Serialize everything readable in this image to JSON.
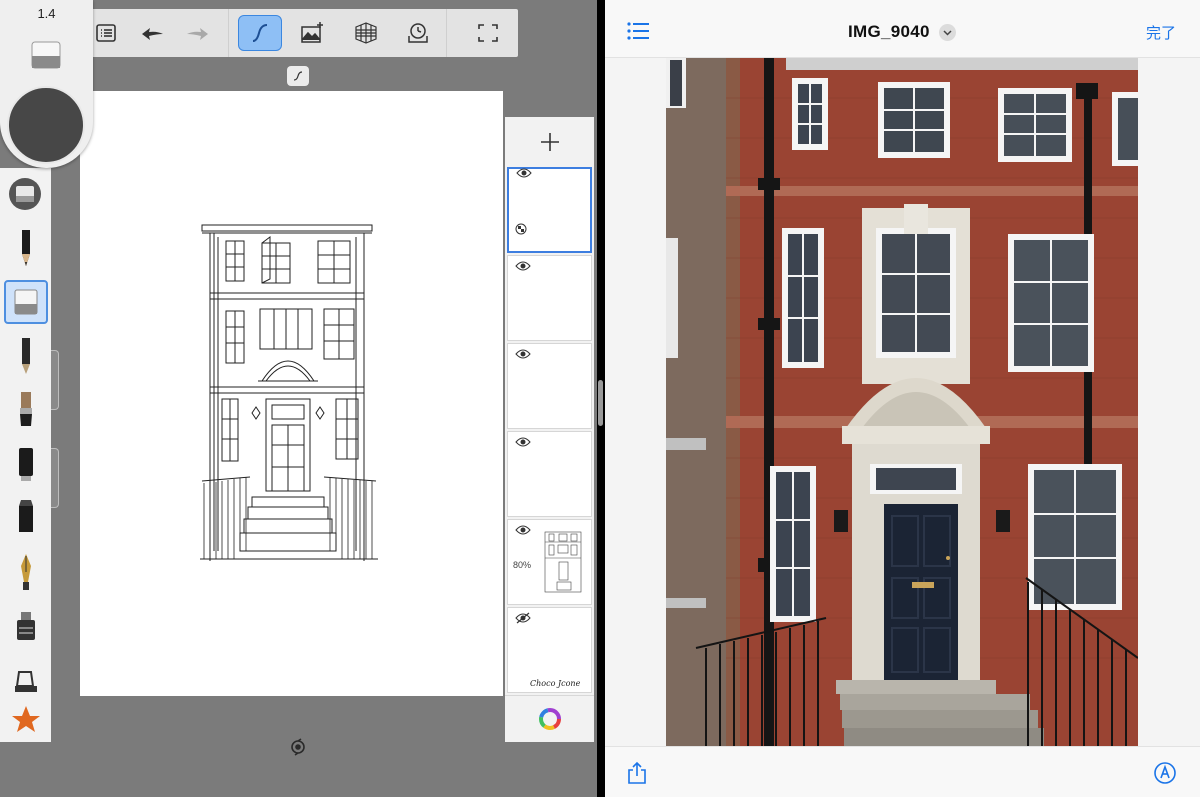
{
  "sketch": {
    "brush_size": "1.4",
    "current_color": "#474747",
    "toolbar": {
      "buttons": [
        {
          "name": "layer-list-icon"
        },
        {
          "name": "undo-icon"
        },
        {
          "name": "redo-icon"
        },
        {
          "name": "stroke-style-icon",
          "active": true
        },
        {
          "name": "add-image-icon"
        },
        {
          "name": "perspective-grid-icon"
        },
        {
          "name": "time-lapse-icon"
        },
        {
          "name": "fullscreen-icon"
        }
      ]
    },
    "tools": [
      "pencil",
      "eraser",
      "ballpoint-pen",
      "paint-brush",
      "marker",
      "chisel-marker",
      "fountain-pen",
      "fill-bucket",
      "ruler-tool",
      "favorites-star"
    ],
    "layers": [
      {
        "visible": true,
        "opacity": "",
        "active": true
      },
      {
        "visible": true,
        "opacity": ""
      },
      {
        "visible": true,
        "opacity": ""
      },
      {
        "visible": true,
        "opacity": ""
      },
      {
        "visible": true,
        "opacity": "80%"
      },
      {
        "visible": false,
        "opacity": "",
        "signature": "Choco Jcone"
      }
    ],
    "accent": "#3b87e0"
  },
  "photos": {
    "title": "IMG_9040",
    "done_label": "完了",
    "accent": "#1a74e8"
  }
}
